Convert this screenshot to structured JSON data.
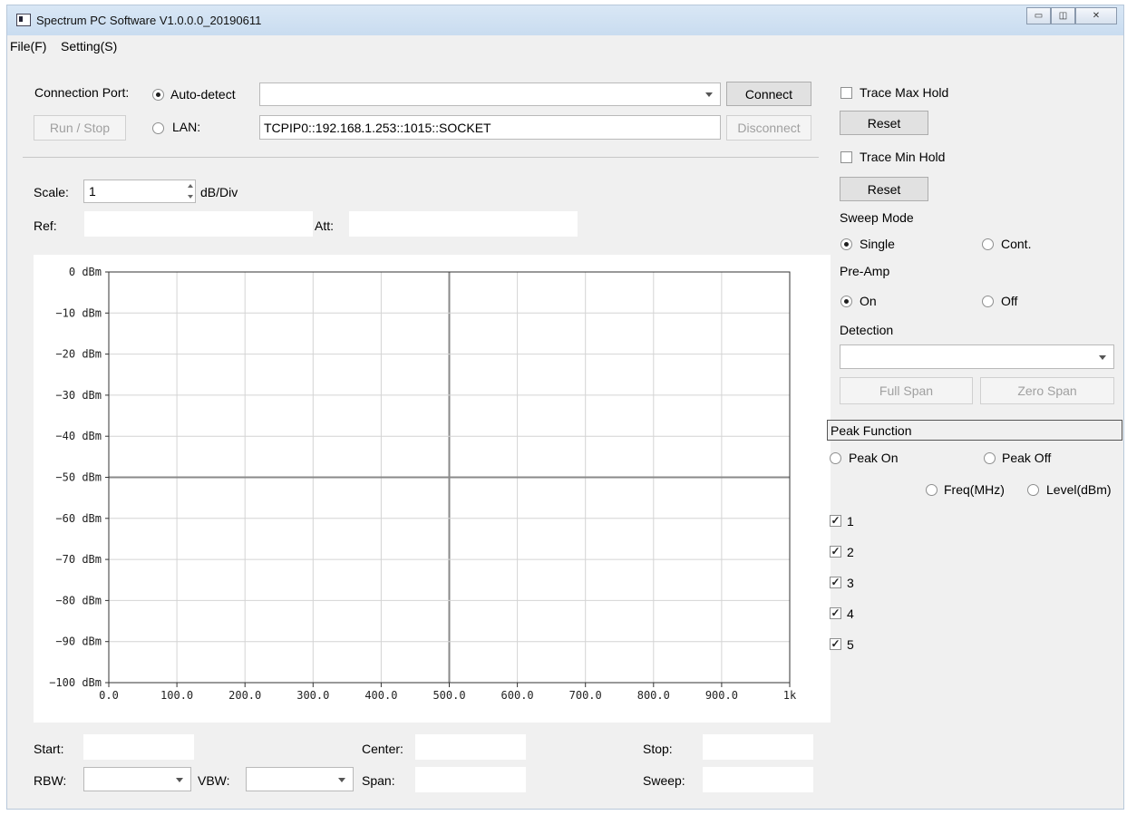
{
  "window": {
    "title": "Spectrum PC Software V1.0.0.0_20190611",
    "minimize_glyph": "▭",
    "maximize_glyph": "◫",
    "close_glyph": "✕"
  },
  "menu": {
    "file": "File(F)",
    "setting": "Setting(S)"
  },
  "connection": {
    "label": "Connection Port:",
    "auto_detect_label": "Auto-detect",
    "auto_detect_selected": true,
    "port_value": "",
    "connect_label": "Connect",
    "run_stop_label": "Run / Stop",
    "lan_label": "LAN:",
    "lan_selected": false,
    "lan_address": "TCPIP0::192.168.1.253::1015::SOCKET",
    "disconnect_label": "Disconnect"
  },
  "scale": {
    "label": "Scale:",
    "value": "1",
    "unit": "dB/Div"
  },
  "ref": {
    "label": "Ref:",
    "value": ""
  },
  "att": {
    "label": "Att:",
    "value": ""
  },
  "chart_data": {
    "type": "line",
    "title": "",
    "xlabel": "",
    "ylabel": "",
    "ylim": [
      -100,
      0
    ],
    "xlim": [
      0,
      1000
    ],
    "y_ticks": [
      "0 dBm",
      "−10 dBm",
      "−20 dBm",
      "−30 dBm",
      "−40 dBm",
      "−50 dBm",
      "−60 dBm",
      "−70 dBm",
      "−80 dBm",
      "−90 dBm",
      "−100 dBm"
    ],
    "x_ticks": [
      "0.0",
      "100.0",
      "200.0",
      "300.0",
      "400.0",
      "500.0",
      "600.0",
      "700.0",
      "800.0",
      "900.0",
      "1k"
    ],
    "grid": true,
    "series": []
  },
  "bottom": {
    "start_label": "Start:",
    "start_value": "",
    "center_label": "Center:",
    "center_value": "",
    "stop_label": "Stop:",
    "stop_value": "",
    "rbw_label": "RBW:",
    "rbw_value": "",
    "vbw_label": "VBW:",
    "vbw_value": "",
    "span_label": "Span:",
    "span_value": "",
    "sweep_label": "Sweep:",
    "sweep_value": ""
  },
  "right": {
    "trace_max_hold_label": "Trace Max Hold",
    "trace_max_hold_checked": false,
    "reset1_label": "Reset",
    "trace_min_hold_label": "Trace Min Hold",
    "trace_min_hold_checked": false,
    "reset2_label": "Reset",
    "sweep_mode_label": "Sweep Mode",
    "single_label": "Single",
    "cont_label": "Cont.",
    "pre_amp_label": "Pre-Amp",
    "on_label": "On",
    "off_label": "Off",
    "detection_label": "Detection",
    "detection_value": "",
    "full_span_label": "Full Span",
    "zero_span_label": "Zero Span",
    "peak_function_label": "Peak Function",
    "peak_on_label": "Peak On",
    "peak_off_label": "Peak Off",
    "freq_label": "Freq(MHz)",
    "level_label": "Level(dBm)",
    "markers": [
      {
        "label": "1",
        "checked": true
      },
      {
        "label": "2",
        "checked": true
      },
      {
        "label": "3",
        "checked": true
      },
      {
        "label": "4",
        "checked": true
      },
      {
        "label": "5",
        "checked": true
      }
    ],
    "checkmark": "✓"
  }
}
